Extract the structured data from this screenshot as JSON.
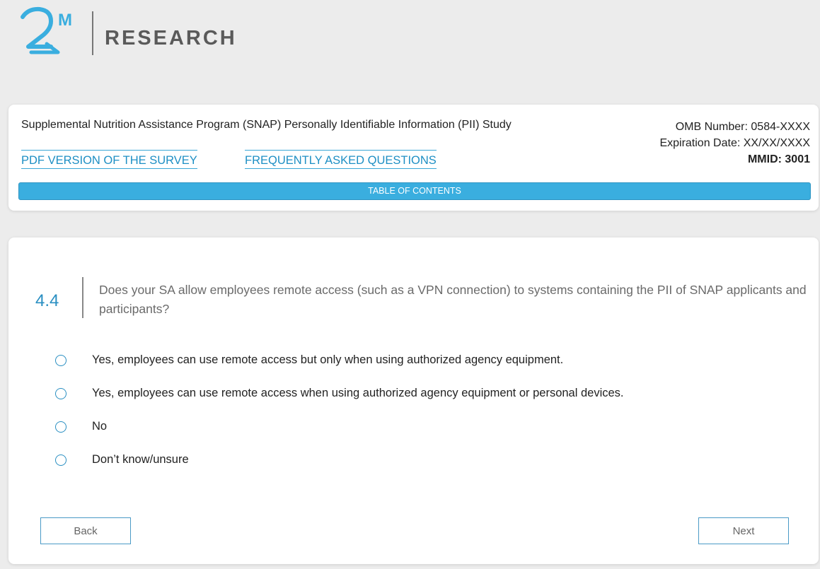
{
  "logo": {
    "mark": "2",
    "superscript": "M",
    "wordmark": "RESEARCH",
    "colors": {
      "mark": "#3aaedf",
      "wordmark": "#5a5a5a"
    }
  },
  "header": {
    "study_title": "Supplemental Nutrition Assistance Program (SNAP) Personally Identifiable Information (PII) Study",
    "omb_number": "OMB Number: 0584-XXXX",
    "expiration_date": "Expiration Date: XX/XX/XXXX",
    "mmid": "MMID: 3001",
    "links": {
      "pdf": "PDF VERSION OF THE SURVEY",
      "faq": "FREQUENTLY ASKED QUESTIONS"
    },
    "toc_label": "TABLE OF CONTENTS"
  },
  "question": {
    "number": "4.4",
    "text": "Does your SA allow employees remote access (such as a VPN connection) to systems containing the PII of SNAP applicants and participants?",
    "options": [
      "Yes, employees can use remote access but only when using authorized agency equipment.",
      "Yes, employees can use remote access when using authorized agency equipment or personal devices.",
      "No",
      "Don’t know/unsure"
    ]
  },
  "nav": {
    "back_label": "Back",
    "next_label": "Next"
  },
  "colors": {
    "accent": "#3aaedf",
    "link": "#1e8fc4",
    "page_background": "#ececec"
  }
}
